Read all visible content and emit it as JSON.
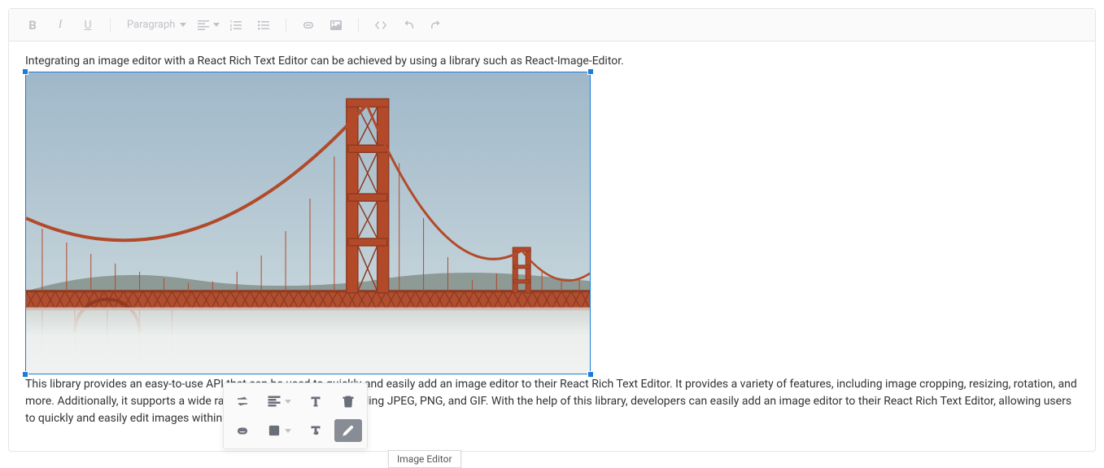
{
  "toolbar": {
    "format_dropdown": "Paragraph"
  },
  "content": {
    "para1": "Integrating an image editor with a React Rich Text Editor can be achieved by using a library such as React-Image-Editor.",
    "para2": "This library provides an easy-to-use API that can be used to quickly and easily add an image editor to their React Rich Text Editor. It provides a variety of features, including image cropping, resizing, rotation, and more. Additionally, it supports a wide range of image formats, including JPEG, PNG, and GIF. With the help of this library, developers can easily add an image editor to their React Rich Text Editor, allowing users to quickly and easily edit images within their documents."
  },
  "image": {
    "alt": "Golden Gate Bridge in fog"
  },
  "tooltip": {
    "image_editor": "Image Editor"
  }
}
